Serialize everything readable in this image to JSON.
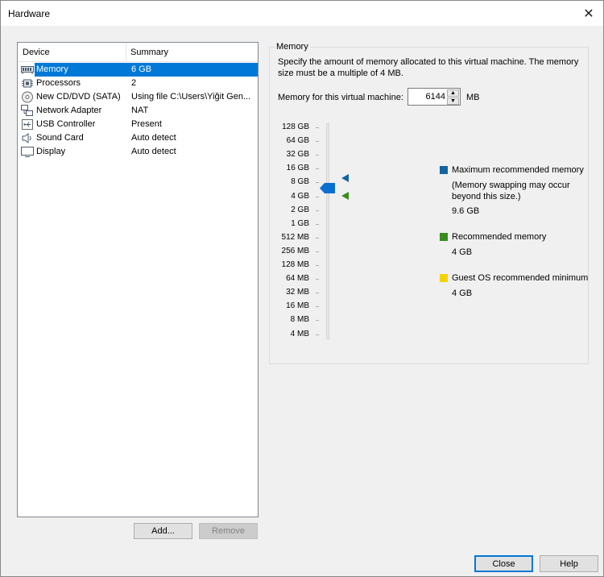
{
  "window": {
    "title": "Hardware",
    "close_glyph": "✕"
  },
  "device_list": {
    "headers": {
      "device": "Device",
      "summary": "Summary"
    },
    "items": [
      {
        "name": "Memory",
        "summary": "6 GB",
        "icon": "memory-icon",
        "selected": true
      },
      {
        "name": "Processors",
        "summary": "2",
        "icon": "processor-icon"
      },
      {
        "name": "New CD/DVD (SATA)",
        "summary": "Using file C:\\Users\\Yiğit Gen...",
        "icon": "cd-dvd-icon"
      },
      {
        "name": "Network Adapter",
        "summary": "NAT",
        "icon": "network-adapter-icon"
      },
      {
        "name": "USB Controller",
        "summary": "Present",
        "icon": "usb-icon"
      },
      {
        "name": "Sound Card",
        "summary": "Auto detect",
        "icon": "speaker-icon"
      },
      {
        "name": "Display",
        "summary": "Auto detect",
        "icon": "monitor-icon"
      }
    ]
  },
  "buttons": {
    "add": "Add...",
    "remove": "Remove",
    "close": "Close",
    "help": "Help"
  },
  "memory": {
    "group_label": "Memory",
    "description": "Specify the amount of memory allocated to this virtual machine. The memory size must be a multiple of 4 MB.",
    "field_label": "Memory for this virtual machine:",
    "value": "6144",
    "unit": "MB",
    "scale": [
      "128 GB",
      "64 GB",
      "32 GB",
      "16 GB",
      "8 GB",
      "4 GB",
      "2 GB",
      "1 GB",
      "512 MB",
      "256 MB",
      "128 MB",
      "64 MB",
      "32 MB",
      "16 MB",
      "8 MB",
      "4 MB"
    ],
    "legend": {
      "max_title": "Maximum recommended memory",
      "max_note": "(Memory swapping may occur beyond this size.)",
      "max_value": "9.6 GB",
      "rec_title": "Recommended memory",
      "rec_value": "4 GB",
      "min_title": "Guest OS recommended minimum",
      "min_value": "4 GB"
    },
    "colors": {
      "max": "#1464a0",
      "recommended": "#3a8c1e",
      "minimum": "#f5d300",
      "thumb": "#0a6fd2"
    }
  }
}
